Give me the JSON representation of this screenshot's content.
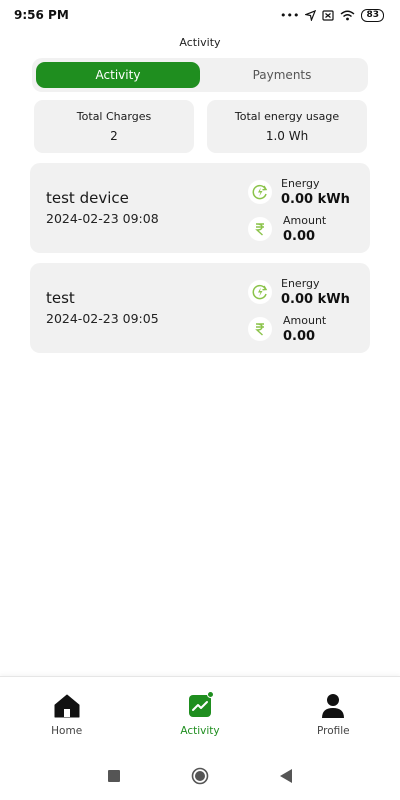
{
  "status": {
    "time": "9:56 PM",
    "battery": "83"
  },
  "page": {
    "title": "Activity"
  },
  "tabs": [
    {
      "label": "Activity",
      "active": true
    },
    {
      "label": "Payments",
      "active": false
    }
  ],
  "summary": {
    "total_charges_label": "Total Charges",
    "total_charges_value": "2",
    "energy_usage_label": "Total energy usage",
    "energy_usage_value": "1.0 Wh"
  },
  "activities": [
    {
      "name": "test device",
      "date": "2024-02-23 09:08",
      "energy_label": "Energy",
      "energy_value": "0.00 kWh",
      "amount_label": "Amount",
      "amount_value": "0.00"
    },
    {
      "name": "test",
      "date": "2024-02-23 09:05",
      "energy_label": "Energy",
      "energy_value": "0.00 kWh",
      "amount_label": "Amount",
      "amount_value": "0.00"
    }
  ],
  "bottom_nav": [
    {
      "label": "Home",
      "icon": "home-icon",
      "active": false
    },
    {
      "label": "Activity",
      "icon": "activity-chart-icon",
      "active": true
    },
    {
      "label": "Profile",
      "icon": "profile-icon",
      "active": false
    }
  ],
  "colors": {
    "accent": "#1f8e1f",
    "card_bg": "#f1f1f1",
    "energy_icon": "#8bc34a"
  }
}
